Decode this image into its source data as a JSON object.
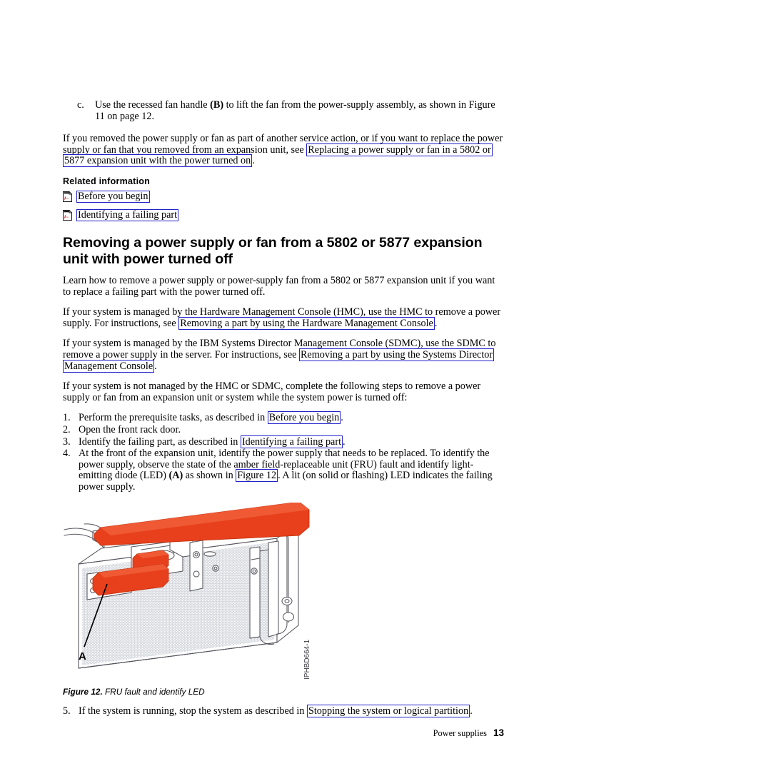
{
  "document": {
    "footer": {
      "section": "Power supplies",
      "page_number": "13"
    }
  },
  "substep_c": {
    "marker": "c.",
    "text_before_b": "Use the recessed fan handle ",
    "bold_b": "(B)",
    "text_after_b": " to lift the fan from the power-supply assembly, as shown in Figure 11 on page 12."
  },
  "intro_paragraph": {
    "text_before_link": "If you removed the power supply or fan as part of another service action, or if you want to replace the power supply or fan that you removed from an expansion unit, see ",
    "link": "Replacing a power supply or fan in a 5802 or 5877 expansion unit with the power turned on",
    "text_after_link": "."
  },
  "related_information": {
    "heading": "Related information",
    "items": [
      {
        "icon": "pdf-icon",
        "label": "Before you begin"
      },
      {
        "icon": "pdf-icon",
        "label": "Identifying a failing part"
      }
    ]
  },
  "section": {
    "heading": "Removing a power supply or fan from a 5802 or 5877 expansion unit with power turned off",
    "lead": "Learn how to remove a power supply or power-supply fan from a 5802 or 5877 expansion unit if you want to replace a failing part with the power turned off.",
    "hmc_paragraph": {
      "before": "If your system is managed by the Hardware Management Console (HMC), use the HMC to remove a power supply. For instructions, see ",
      "link": "Removing a part by using the Hardware Management Console",
      "after": "."
    },
    "sdmc_paragraph": {
      "before": "If your system is managed by the IBM Systems Director Management Console (SDMC), use the SDMC to remove a power supply in the server. For instructions, see ",
      "link": "Removing a part by using the Systems Director Management Console",
      "after": "."
    },
    "steps_lead": "If your system is not managed by the HMC or SDMC, complete the following steps to remove a power supply or fan from an expansion unit or system while the system power is turned off:"
  },
  "steps": [
    {
      "number": "1.",
      "before": "Perform the prerequisite tasks, as described in ",
      "link": "Before you begin",
      "after": "."
    },
    {
      "number": "2.",
      "before": "Open the front rack door.",
      "link": "",
      "after": ""
    },
    {
      "number": "3.",
      "before": "Identify the failing part, as described in ",
      "link": "Identifying a failing part",
      "after": "."
    },
    {
      "number": "4.",
      "before": "At the front of the expansion unit, identify the power supply that needs to be replaced. To identify the power supply, observe the state of the amber field-replaceable unit (FRU) fault and identify light-emitting diode (LED) ",
      "bold": "(A)",
      "middle": " as shown in ",
      "link": "Figure 12",
      "after": ". A lit (on solid or flashing) LED indicates the failing power supply."
    }
  ],
  "step5": {
    "number": "5.",
    "before": "If the system is running, stop the system as described in ",
    "link": "Stopping the system or logical partition",
    "after": "."
  },
  "figure": {
    "caption_label": "Figure 12.",
    "caption_text": " FRU fault and identify LED",
    "callout_a": "A",
    "part_number": "IPHBD664-1",
    "colors": {
      "handle_orange": "#e8401c",
      "line_art": "#4a4a52",
      "mesh_gray": "#b8bcc4"
    }
  },
  "colors": {
    "link_box_border": "#2222cc",
    "text": "#000000",
    "pdf_icon_red": "#cc2222"
  }
}
